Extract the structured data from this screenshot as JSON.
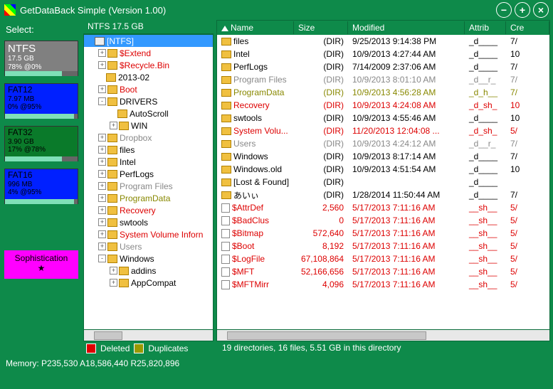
{
  "title": "GetDataBack Simple (Version 1.00)",
  "select_label": "Select:",
  "volumes": [
    {
      "name": "NTFS",
      "size": "17.5 GB",
      "pct": "78% @0%",
      "type": "ntfs",
      "fill": 78
    },
    {
      "name": "FAT12",
      "size": "7.97 MB",
      "pct": "0% @95%",
      "type": "fat12",
      "fill": 95
    },
    {
      "name": "FAT32",
      "size": "3.90 GB",
      "pct": "17% @78%",
      "type": "fat32",
      "fill": 78
    },
    {
      "name": "FAT16",
      "size": "996 MB",
      "pct": "4% @95%",
      "type": "fat16",
      "fill": 95
    }
  ],
  "sophistication": "Sophistication",
  "star": "★",
  "tree_header": "NTFS 17.5 GB",
  "tree": [
    {
      "indent": 0,
      "exp": "",
      "label": "[NTFS]",
      "cls": "sel",
      "icon": "drv"
    },
    {
      "indent": 1,
      "exp": "+",
      "label": "$Extend",
      "cls": "red"
    },
    {
      "indent": 1,
      "exp": "+",
      "label": "$Recycle.Bin",
      "cls": "red"
    },
    {
      "indent": 1,
      "exp": "",
      "label": "2013-02",
      "cls": ""
    },
    {
      "indent": 1,
      "exp": "+",
      "label": "Boot",
      "cls": "red"
    },
    {
      "indent": 1,
      "exp": "-",
      "label": "DRIVERS",
      "cls": ""
    },
    {
      "indent": 2,
      "exp": "",
      "label": "AutoScroll",
      "cls": ""
    },
    {
      "indent": 2,
      "exp": "+",
      "label": "WIN",
      "cls": ""
    },
    {
      "indent": 1,
      "exp": "+",
      "label": "Dropbox",
      "cls": "gray"
    },
    {
      "indent": 1,
      "exp": "+",
      "label": "files",
      "cls": ""
    },
    {
      "indent": 1,
      "exp": "+",
      "label": "Intel",
      "cls": ""
    },
    {
      "indent": 1,
      "exp": "+",
      "label": "PerfLogs",
      "cls": ""
    },
    {
      "indent": 1,
      "exp": "+",
      "label": "Program Files",
      "cls": "gray"
    },
    {
      "indent": 1,
      "exp": "+",
      "label": "ProgramData",
      "cls": "olive"
    },
    {
      "indent": 1,
      "exp": "+",
      "label": "Recovery",
      "cls": "red"
    },
    {
      "indent": 1,
      "exp": "+",
      "label": "swtools",
      "cls": ""
    },
    {
      "indent": 1,
      "exp": "+",
      "label": "System Volume Inforn",
      "cls": "red"
    },
    {
      "indent": 1,
      "exp": "+",
      "label": "Users",
      "cls": "gray"
    },
    {
      "indent": 1,
      "exp": "-",
      "label": "Windows",
      "cls": ""
    },
    {
      "indent": 2,
      "exp": "+",
      "label": "addins",
      "cls": ""
    },
    {
      "indent": 2,
      "exp": "+",
      "label": "AppCompat",
      "cls": ""
    }
  ],
  "legend": {
    "deleted": "Deleted",
    "duplicates": "Duplicates"
  },
  "columns": {
    "name": "Name",
    "size": "Size",
    "modified": "Modified",
    "attrib": "Attrib",
    "created": "Cre"
  },
  "files": [
    {
      "icon": "folder",
      "name": "files",
      "size": "(DIR)",
      "mod": "9/25/2013 9:14:38 PM",
      "attr": "_d____",
      "cre": "7/",
      "cls": ""
    },
    {
      "icon": "folder",
      "name": "Intel",
      "size": "(DIR)",
      "mod": "10/9/2013 4:27:44 AM",
      "attr": "_d____",
      "cre": "10",
      "cls": ""
    },
    {
      "icon": "folder",
      "name": "PerfLogs",
      "size": "(DIR)",
      "mod": "7/14/2009 2:37:06 AM",
      "attr": "_d____",
      "cre": "7/",
      "cls": ""
    },
    {
      "icon": "folder",
      "name": "Program Files",
      "size": "(DIR)",
      "mod": "10/9/2013 8:01:10 AM",
      "attr": "_d__r_",
      "cre": "7/",
      "cls": "gray"
    },
    {
      "icon": "folder",
      "name": "ProgramData",
      "size": "(DIR)",
      "mod": "10/9/2013 4:56:28 AM",
      "attr": "_d_h__",
      "cre": "7/",
      "cls": "olive"
    },
    {
      "icon": "folder",
      "name": "Recovery",
      "size": "(DIR)",
      "mod": "10/9/2013 4:24:08 AM",
      "attr": "_d_sh_",
      "cre": "10",
      "cls": "red"
    },
    {
      "icon": "folder",
      "name": "swtools",
      "size": "(DIR)",
      "mod": "10/9/2013 4:55:46 AM",
      "attr": "_d____",
      "cre": "10",
      "cls": ""
    },
    {
      "icon": "folder",
      "name": "System Volu...",
      "size": "(DIR)",
      "mod": "11/20/2013 12:04:08 ...",
      "attr": "_d_sh_",
      "cre": "5/",
      "cls": "red"
    },
    {
      "icon": "folder",
      "name": "Users",
      "size": "(DIR)",
      "mod": "10/9/2013 4:24:12 AM",
      "attr": "_d__r_",
      "cre": "7/",
      "cls": "gray"
    },
    {
      "icon": "folder",
      "name": "Windows",
      "size": "(DIR)",
      "mod": "10/9/2013 8:17:14 AM",
      "attr": "_d____",
      "cre": "7/",
      "cls": ""
    },
    {
      "icon": "folder",
      "name": "Windows.old",
      "size": "(DIR)",
      "mod": "10/9/2013 4:51:54 AM",
      "attr": "_d____",
      "cre": "10",
      "cls": ""
    },
    {
      "icon": "folder",
      "name": "[Lost & Found]",
      "size": "(DIR)",
      "mod": "",
      "attr": "_d____",
      "cre": "",
      "cls": ""
    },
    {
      "icon": "folder",
      "name": "あいぃ",
      "size": "(DIR)",
      "mod": "1/28/2014 11:50:44 AM",
      "attr": "_d____",
      "cre": "7/",
      "cls": ""
    },
    {
      "icon": "file",
      "name": "$AttrDef",
      "size": "2,560",
      "mod": "5/17/2013 7:11:16 AM",
      "attr": "__sh__",
      "cre": "5/",
      "cls": "red"
    },
    {
      "icon": "file",
      "name": "$BadClus",
      "size": "0",
      "mod": "5/17/2013 7:11:16 AM",
      "attr": "__sh__",
      "cre": "5/",
      "cls": "red"
    },
    {
      "icon": "file",
      "name": "$Bitmap",
      "size": "572,640",
      "mod": "5/17/2013 7:11:16 AM",
      "attr": "__sh__",
      "cre": "5/",
      "cls": "red"
    },
    {
      "icon": "file",
      "name": "$Boot",
      "size": "8,192",
      "mod": "5/17/2013 7:11:16 AM",
      "attr": "__sh__",
      "cre": "5/",
      "cls": "red"
    },
    {
      "icon": "file",
      "name": "$LogFile",
      "size": "67,108,864",
      "mod": "5/17/2013 7:11:16 AM",
      "attr": "__sh__",
      "cre": "5/",
      "cls": "red"
    },
    {
      "icon": "file",
      "name": "$MFT",
      "size": "52,166,656",
      "mod": "5/17/2013 7:11:16 AM",
      "attr": "__sh__",
      "cre": "5/",
      "cls": "red"
    },
    {
      "icon": "file",
      "name": "$MFTMirr",
      "size": "4,096",
      "mod": "5/17/2013 7:11:16 AM",
      "attr": "__sh__",
      "cre": "5/",
      "cls": "red"
    }
  ],
  "status_right": "19 directories, 16 files, 5.51 GB in this directory",
  "memory": "Memory: P235,530 A18,586,440 R25,820,896"
}
